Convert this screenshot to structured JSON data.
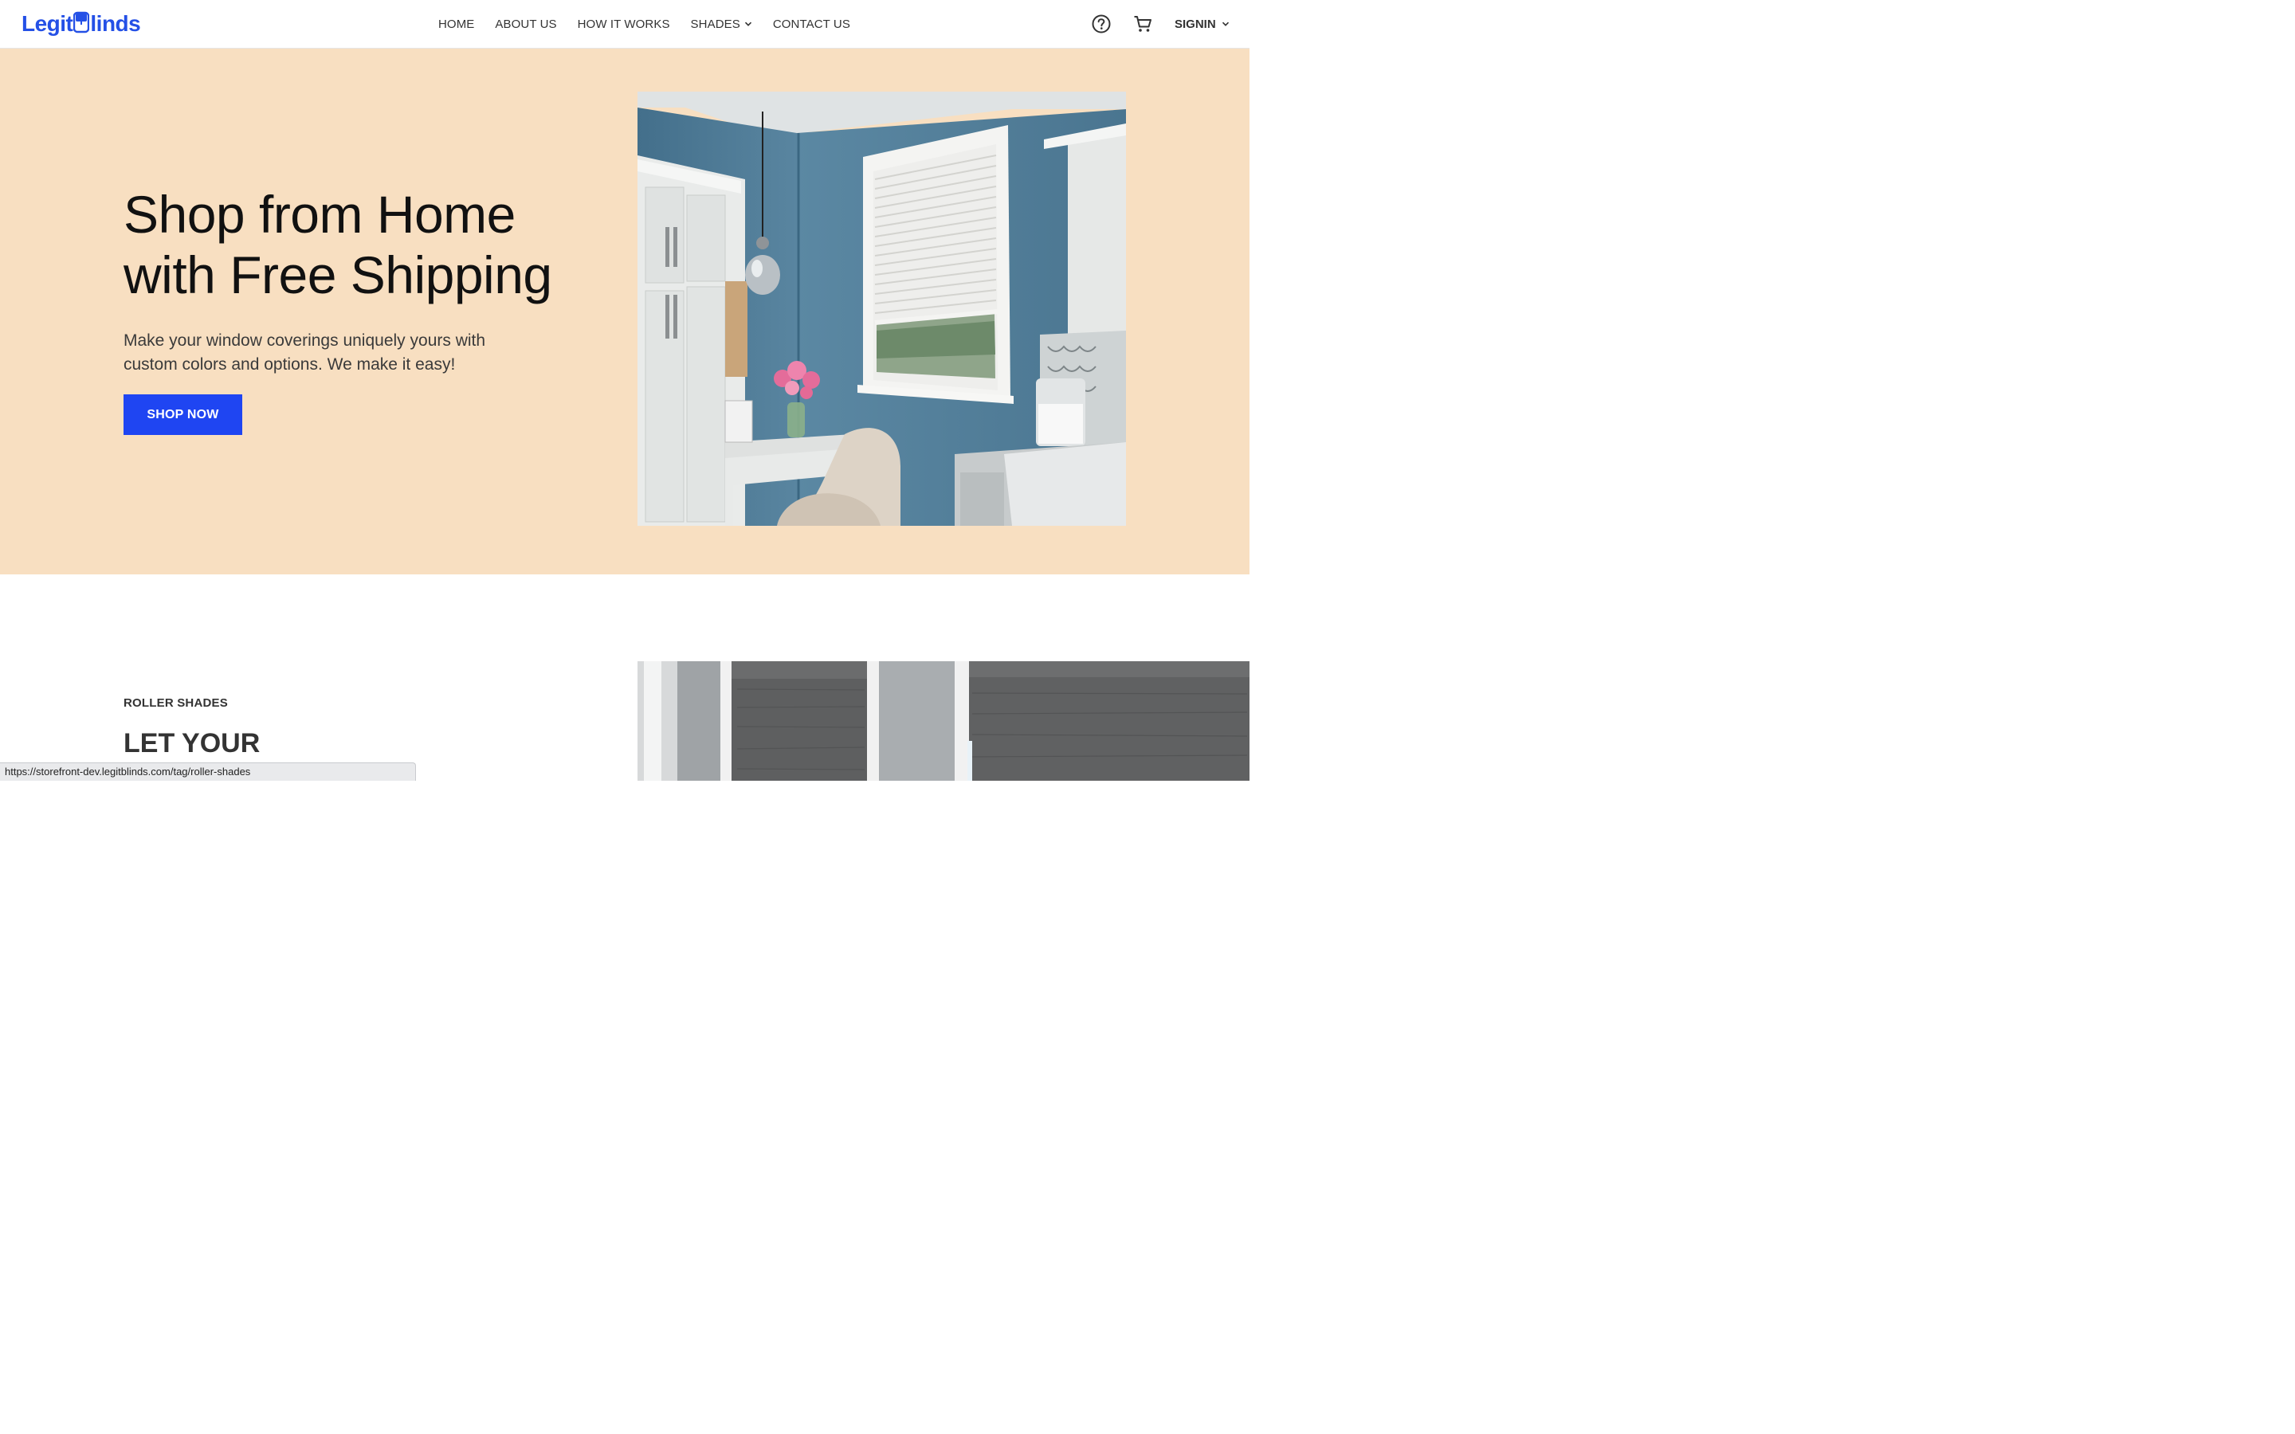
{
  "header": {
    "logo_alt": "LegitBlinds",
    "logo_part1": "Legit",
    "logo_part2": "linds",
    "nav": [
      {
        "label": "HOME"
      },
      {
        "label": "ABOUT US"
      },
      {
        "label": "HOW IT WORKS"
      },
      {
        "label": "SHADES",
        "has_dropdown": true
      },
      {
        "label": "CONTACT US"
      }
    ],
    "help_icon": "question-circle-icon",
    "cart_icon": "shopping-cart-icon",
    "signin_label": "SIGNIN"
  },
  "hero": {
    "title_line1": "Shop from Home",
    "title_line2": "with Free Shipping",
    "subtitle_line1": "Make your window coverings uniquely yours with",
    "subtitle_line2": "custom colors and options. We make it easy!",
    "cta_label": "SHOP NOW",
    "image_alt": "Laundry room with white window blinds"
  },
  "section2": {
    "eyebrow": "ROLLER SHADES",
    "title": "LET YOUR",
    "image_alt": "Gray roller shades on windows"
  },
  "status_bar": {
    "url": "https://storefront-dev.legitblinds.com/tag/roller-shades"
  },
  "colors": {
    "brand_blue": "#2450e6",
    "cta_blue": "#1f45f2",
    "hero_bg": "#f8dfc1",
    "wall_blue": "#4f7c97"
  }
}
